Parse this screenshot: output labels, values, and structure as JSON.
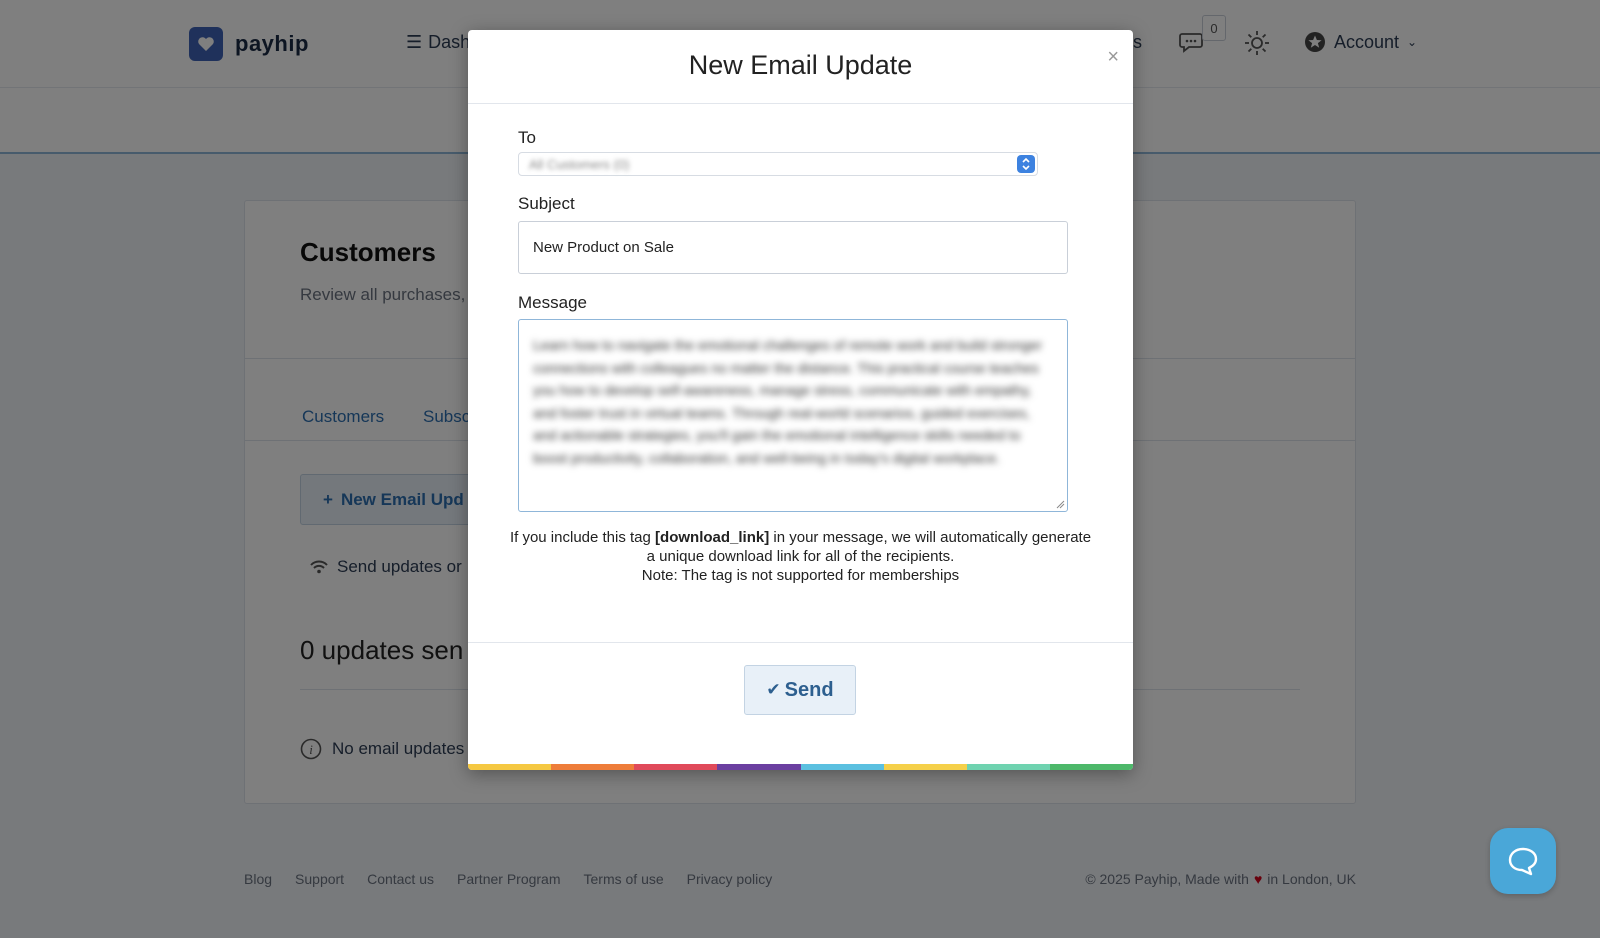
{
  "brand": {
    "name": "payhip"
  },
  "nav": {
    "dashboard_label": "Dash",
    "customers_fragment": "ers",
    "notification_count": "0",
    "account_label": "Account"
  },
  "page": {
    "title": "Customers",
    "subtitle": "Review all purchases,",
    "tabs": [
      {
        "label": "Customers"
      },
      {
        "label": "Subsc"
      }
    ],
    "new_update_button": "New Email Upd",
    "send_updates_text": "Send updates or",
    "updates_sent_text": "0 updates sen",
    "no_updates_text": "No email updates"
  },
  "footer": {
    "links": [
      "Blog",
      "Support",
      "Contact us",
      "Partner Program",
      "Terms of use",
      "Privacy policy"
    ],
    "copyright_prefix": "© 2025 Payhip, Made with",
    "heart": "♥",
    "copyright_suffix": "in London, UK"
  },
  "modal": {
    "title": "New Email Update",
    "close_label": "×",
    "to_label": "To",
    "to_value": "All Customers (0)",
    "subject_label": "Subject",
    "subject_value": "New Product on Sale",
    "message_label": "Message",
    "message_value": "Learn how to navigate the emotional challenges of remote work and build stronger connections with colleagues no matter the distance. This practical course teaches you how to develop self-awareness, manage stress, communicate with empathy, and foster trust in virtual teams. Through real-world scenarios, guided exercises, and actionable strategies, you'll gain the emotional intelligence skills needed to boost productivity, collaboration, and well-being in today's digital workplace.",
    "help_text_before": "If you include this tag",
    "help_tag": "[download_link]",
    "help_text_after": "in your message, we will automatically generate a unique download link for all of the recipients.",
    "help_note": "Note: The tag is not supported for memberships",
    "send_label": "Send"
  },
  "colors": {
    "accent": "#2d6fb0",
    "help_button": "#4aa7d8",
    "stripe": [
      "#f5c842",
      "#ee7d3a",
      "#e04a5a",
      "#6b3fa0",
      "#5bc0e0",
      "#f5d04a",
      "#6fd3b0",
      "#4db86a"
    ]
  }
}
